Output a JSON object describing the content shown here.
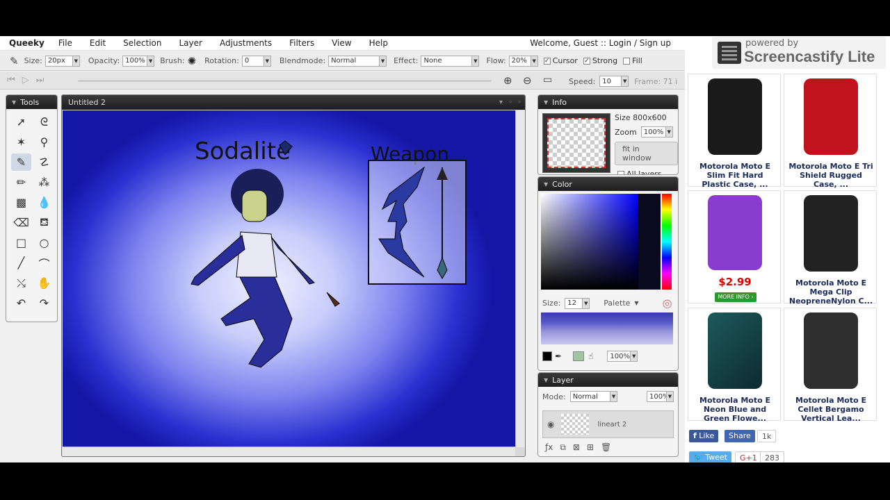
{
  "app": {
    "brand": "Queeky",
    "menu": [
      "File",
      "Edit",
      "Selection",
      "Layer",
      "Adjustments",
      "Filters",
      "View",
      "Help"
    ],
    "welcome": "Welcome, Guest :: Login / Sign up"
  },
  "toolbar": {
    "size_label": "Size:",
    "size_value": "20px",
    "opacity_label": "Opacity:",
    "opacity_value": "100%",
    "brush_label": "Brush:",
    "rotation_label": "Rotation:",
    "rotation_value": "0",
    "blendmode_label": "Blendmode:",
    "blendmode_value": "Normal",
    "effect_label": "Effect:",
    "effect_value": "None",
    "flow_label": "Flow:",
    "flow_value": "20%",
    "cursor_label": "Cursor",
    "strong_label": "Strong",
    "fill_label": "Fill"
  },
  "playbar": {
    "speed_label": "Speed:",
    "speed_value": "10",
    "frame_label": "Frame: 71 i"
  },
  "tools_panel": {
    "title": "Tools"
  },
  "canvas": {
    "title": "Untitled 2",
    "text_name": "Sodalite",
    "text_weapon": "Weapon"
  },
  "info_panel": {
    "title": "Info",
    "size": "Size  800x600",
    "zoom_label": "Zoom",
    "zoom_value": "100%",
    "fit_button": "fit in window",
    "all_layers": "All layers"
  },
  "color_panel": {
    "title": "Color",
    "size_label": "Size:",
    "size_value": "12",
    "palette_label": "Palette",
    "opacity_value": "100%"
  },
  "layer_panel": {
    "title": "Layer",
    "mode_label": "Mode:",
    "mode_value": "Normal",
    "opacity_value": "100%",
    "layer_name": "lineart 2"
  },
  "screencastify": {
    "powered": "powered by",
    "name": "Screencastify Lite"
  },
  "ads": [
    {
      "title": "Motorola Moto E Slim Fit Hard Plastic Case, ...",
      "color": "#1a1a1a"
    },
    {
      "title": "Motorola Moto E Tri Shield Rugged Case, ...",
      "color": "#c0141c"
    },
    {
      "title": "",
      "color": "#8a3ccf",
      "price": "$2.99",
      "more": "MORE INFO ›"
    },
    {
      "title": "Motorola Moto E Mega Clip NeopreneNylon C...",
      "color": "#222222"
    },
    {
      "title": "Motorola Moto E Neon Blue and Green Flowe...",
      "color": "#1e5a5a"
    },
    {
      "title": "Motorola Moto E Cellet Bergamo Vertical Lea...",
      "color": "#2e2e2e"
    }
  ],
  "social": {
    "like": "Like",
    "share": "Share",
    "share_count": "1k",
    "tweet": "Tweet",
    "gplus": "G+1",
    "gplus_count": "283"
  }
}
